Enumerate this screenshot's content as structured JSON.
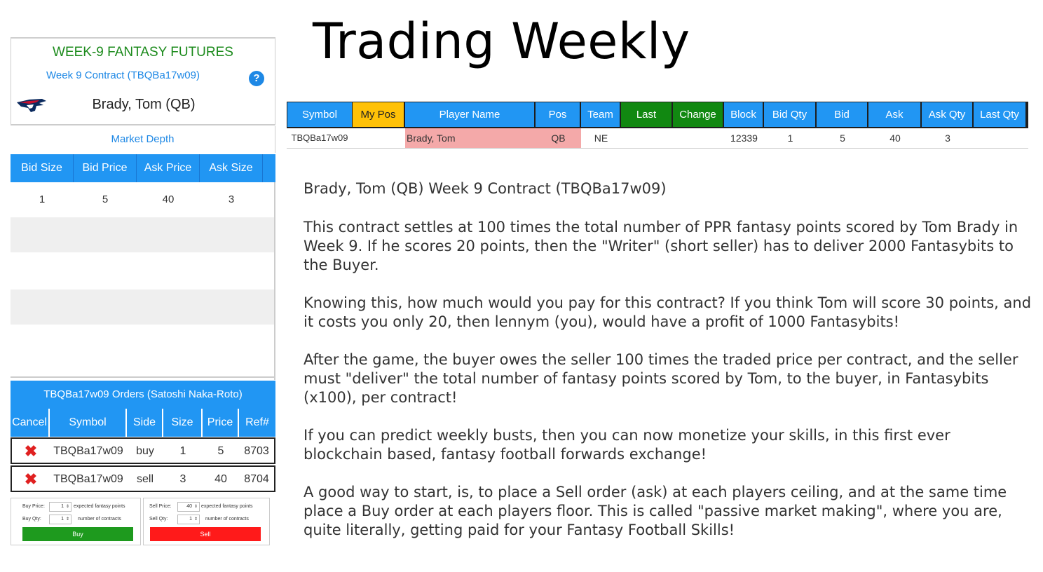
{
  "page_title": "Trading Weekly",
  "left_panel": {
    "header": "WEEK-9 FANTASY FUTURES",
    "contract_label": "Week 9 Contract  (TBQBa17w09)",
    "help_icon": "?",
    "team_logo": "patriots-logo",
    "player_name": "Brady, Tom (QB)",
    "market_depth": {
      "title": "Market Depth",
      "columns": [
        "Bid Size",
        "Bid Price",
        "Ask Price",
        "Ask Size"
      ],
      "rows": [
        [
          "1",
          "5",
          "40",
          "3"
        ]
      ]
    },
    "orders": {
      "title": "TBQBa17w09 Orders (Satoshi Naka-Roto)",
      "columns": [
        "Cancel",
        "Symbol",
        "Side",
        "Size",
        "Price",
        "Ref#"
      ],
      "rows": [
        {
          "symbol": "TBQBa17w09",
          "side": "buy",
          "size": "1",
          "price": "5",
          "ref": "8703"
        },
        {
          "symbol": "TBQBa17w09",
          "side": "sell",
          "size": "3",
          "price": "40",
          "ref": "8704"
        }
      ]
    },
    "buy_box": {
      "price_label": "Buy Price:",
      "price_value": "1",
      "price_hint": "expected fantasy points",
      "qty_label": "Buy Qty:",
      "qty_value": "1",
      "qty_hint": "number of contracts",
      "button": "Buy",
      "color": "#1e9a1e"
    },
    "sell_box": {
      "price_label": "Sell Price:",
      "price_value": "40",
      "price_hint": "expected fantasy points",
      "qty_label": "Sell Qty:",
      "qty_value": "1",
      "qty_hint": "number of contracts",
      "button": "Sell",
      "color": "#ff1a1a"
    }
  },
  "market_table": {
    "columns": [
      "Symbol",
      "My Pos",
      "Player Name",
      "Pos",
      "Team",
      "Last",
      "Change",
      "Block",
      "Bid Qty",
      "Bid",
      "Ask",
      "Ask Qty",
      "Last Qty"
    ],
    "header_colors": [
      "#2196f3",
      "#ffc107",
      "#2196f3",
      "#2196f3",
      "#2196f3",
      "#118811",
      "#118811",
      "#2196f3",
      "#2196f3",
      "#2196f3",
      "#2196f3",
      "#2196f3",
      "#2196f3"
    ],
    "row": {
      "symbol": "TBQBa17w09",
      "my_pos": "",
      "player_name": "Brady, Tom",
      "pos": "QB",
      "team": "NE",
      "last": "",
      "change": "",
      "block": "12339",
      "bid_qty": "1",
      "bid": "5",
      "ask": "40",
      "ask_qty": "3",
      "last_qty": ""
    },
    "highlight_color": "#f4a9a9"
  },
  "description": {
    "heading": "Brady, Tom (QB) Week 9 Contract  (TBQBa17w09)",
    "paragraphs": [
      "This contract settles at 100 times the total number of PPR fantasy points scored by Tom Brady in Week 9. If he scores 20 points, then the \"Writer\" (short seller) has to deliver 2000 Fantasybits to the Buyer.",
      "Knowing this, how much would you pay for this contract? If you think Tom will score 30 points, and it costs you only 20, then lennym (you), would have a profit of 1000 Fantasybits!",
      "After the game, the buyer owes the seller 100 times the traded price per contract, and the seller must \"deliver\" the total number of fantasy points scored by Tom,  to the buyer, in Fantasybits (x100),  per contract!",
      "If you can predict weekly busts, then you can now monetize your skills, in this first ever blockchain based, fantasy football forwards exchange!",
      "A good way to start, is, to place a Sell order (ask) at each players ceiling, and at the same time place a Buy order at each players floor. This is called \"passive market making\", where you are, quite literally, getting paid for your Fantasy Football Skills!"
    ]
  }
}
